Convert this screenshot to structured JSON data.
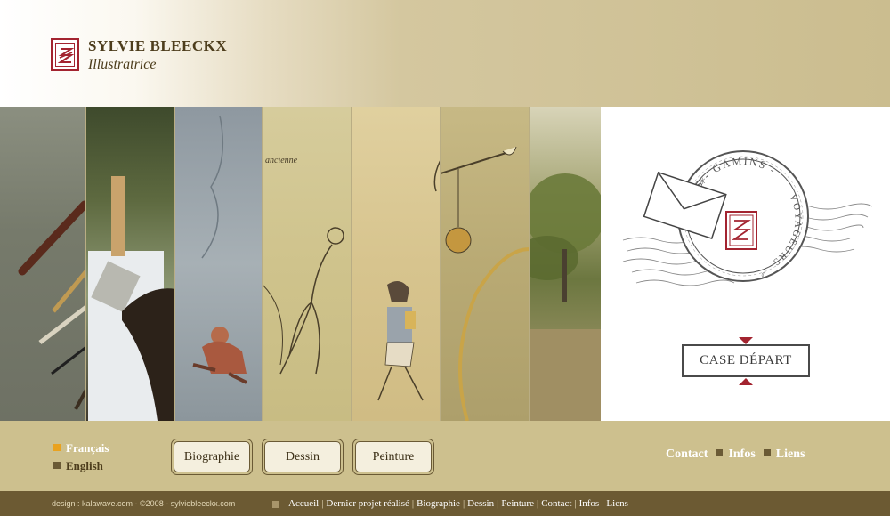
{
  "header": {
    "title": "SYLVIE BLEECKX",
    "subtitle": "Illustratrice",
    "logo_icon": "sb-monogram-icon",
    "accent_color": "#a32430"
  },
  "hero": {
    "strip_count": 7,
    "strip_text": "ancienne",
    "stamp_text": [
      "LES",
      "GAMINS",
      "VOYAGEURS"
    ],
    "cta_label": "CASE DÉPART"
  },
  "languages": [
    {
      "label": "Français",
      "active": true
    },
    {
      "label": "English",
      "active": false
    }
  ],
  "nav_buttons": [
    "Biographie",
    "Dessin",
    "Peinture"
  ],
  "right_links": [
    "Contact",
    "Infos",
    "Liens"
  ],
  "footer": {
    "credit": "design : kalawave.com - ©2008 - sylviebleeckx.com",
    "links": [
      "Accueil",
      "Dernier projet réalisé",
      "Biographie",
      "Dessin",
      "Peinture",
      "Contact",
      "Infos",
      "Liens"
    ]
  }
}
